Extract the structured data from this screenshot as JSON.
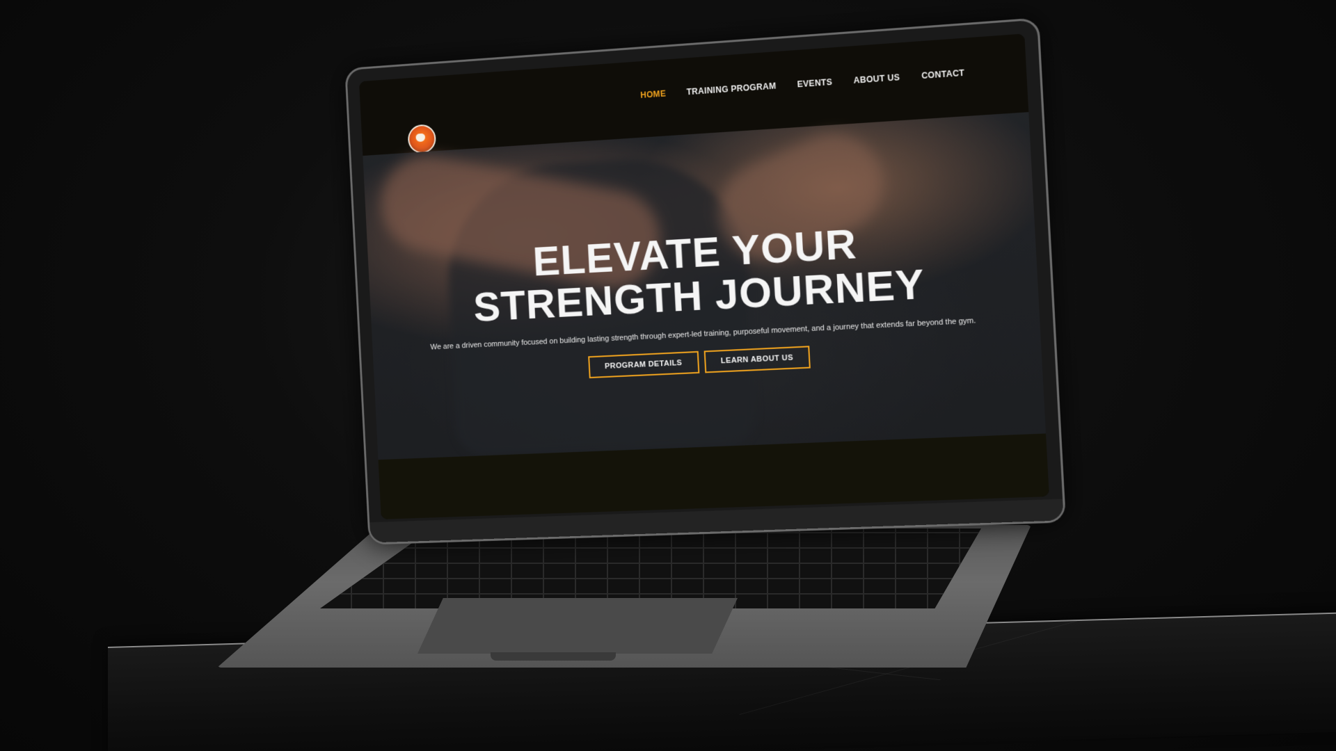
{
  "nav": {
    "items": [
      {
        "label": "HOME",
        "active": true
      },
      {
        "label": "TRAINING PROGRAM",
        "active": false
      },
      {
        "label": "EVENTS",
        "active": false
      },
      {
        "label": "ABOUT US",
        "active": false
      },
      {
        "label": "CONTACT",
        "active": false
      }
    ]
  },
  "hero": {
    "title_line1": "ELEVATE YOUR",
    "title_line2": "STRENGTH JOURNEY",
    "subtitle": "We are a driven community focused on building lasting strength through expert-led training, purposeful movement, and a journey that extends far beyond the gym.",
    "primary_button": "PROGRAM DETAILS",
    "secondary_button": "LEARN ABOUT US"
  },
  "theme": {
    "accent": "#f2a41e",
    "nav_bg": "#0f0d08",
    "text": "#f5f5f5"
  },
  "icons": {
    "logo": "lion-logo-icon"
  }
}
